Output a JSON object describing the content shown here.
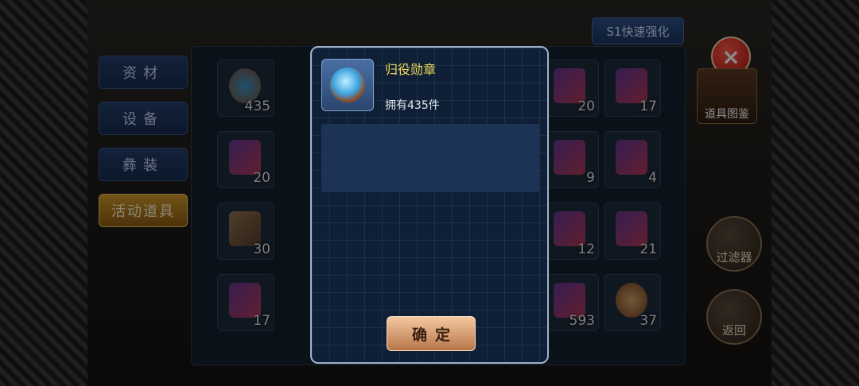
{
  "top_button": "S1快速强化",
  "close_icon": "×",
  "categories": [
    {
      "label": "资材",
      "active": false
    },
    {
      "label": "设备",
      "active": false
    },
    {
      "label": "彝装",
      "active": false
    },
    {
      "label": "活动道具",
      "active": true
    }
  ],
  "grid": {
    "slots": [
      {
        "count": "435",
        "kind": "medal"
      },
      {
        "count": "17",
        "kind": "card"
      },
      {
        "count": "20",
        "kind": "card"
      },
      {
        "count": "4",
        "kind": "card"
      },
      {
        "count": "30",
        "kind": "book"
      },
      {
        "count": "21",
        "kind": "card"
      },
      {
        "count": "17",
        "kind": "card"
      },
      {
        "count": "37",
        "kind": "coin"
      },
      {
        "count": "20",
        "kind": "card"
      },
      {
        "count": "9",
        "kind": "card"
      },
      {
        "count": "12",
        "kind": "card"
      },
      {
        "count": "593",
        "kind": "card"
      }
    ]
  },
  "right_tools": {
    "book_label": "道具图鉴",
    "filter_label": "过滤器",
    "back_label": "返回"
  },
  "modal": {
    "item_name": "归役勋章",
    "owned_text": "拥有435件",
    "confirm_label": "确定"
  }
}
